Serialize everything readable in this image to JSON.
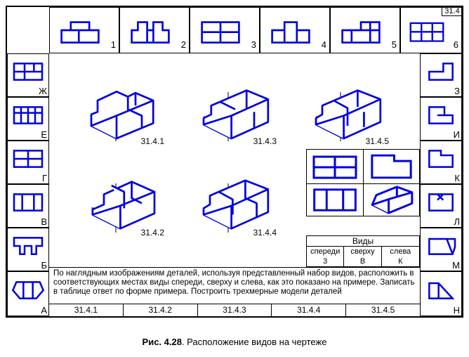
{
  "badge": "31.4",
  "top_row": [
    {
      "num": "1"
    },
    {
      "num": "2"
    },
    {
      "num": "3"
    },
    {
      "num": "4"
    },
    {
      "num": "5"
    },
    {
      "num": "6"
    }
  ],
  "left_col": [
    {
      "letter": "Ж"
    },
    {
      "letter": "Е"
    },
    {
      "letter": "Г"
    },
    {
      "letter": "В"
    },
    {
      "letter": "Б"
    },
    {
      "letter": "А"
    }
  ],
  "right_col": [
    {
      "letter": "З"
    },
    {
      "letter": "И"
    },
    {
      "letter": "К"
    },
    {
      "letter": "Л"
    },
    {
      "letter": "М"
    },
    {
      "letter": "Н"
    }
  ],
  "iso_labels": {
    "a": "31.4.1",
    "b": "31.4.2",
    "c": "31.4.3",
    "d": "31.4.4",
    "e": "31.4.5"
  },
  "views_table": {
    "title": "Виды",
    "headers": [
      "спереди",
      "сверху",
      "слева"
    ],
    "example_answers": [
      "3",
      "В",
      "К"
    ]
  },
  "answer_strip": [
    "31.4.1",
    "31.4.2",
    "31.4.3",
    "31.4.4",
    "31.4.5"
  ],
  "task_text": "По наглядным изображениям деталей, используя представленный набор видов, расположить в соответствующих местах виды спереди, сверху и слева, как это показано на примере. Записать в таблице ответ по форме примера. Построить трехмерные модели деталей",
  "caption_bold": "Рис. 4.28",
  "caption_rest": ". Расположение видов на чертеже"
}
